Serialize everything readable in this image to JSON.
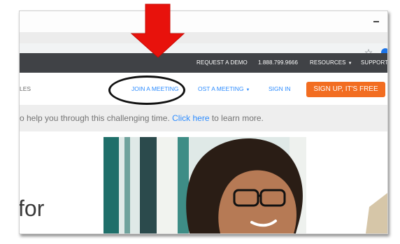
{
  "topbar": {
    "request_demo": "REQUEST A DEMO",
    "phone": "1.888.799.9666",
    "resources": "RESOURCES",
    "support": "SUPPORT"
  },
  "nav": {
    "sales_partial": "LES",
    "join": "JOIN A MEETING",
    "host_partial": "OST A MEETING",
    "sign_in": "SIGN IN",
    "signup": "SIGN UP, IT'S FREE"
  },
  "banner": {
    "text_before": "o help you through this challenging time. ",
    "link": "Click here",
    "text_after": " to learn more."
  },
  "hero": {
    "headline_partial": "for"
  },
  "colors": {
    "brand_blue": "#2d8cff",
    "cta_orange": "#f26d21",
    "topbar_dark": "#404246",
    "arrow_red": "#e8120c"
  },
  "icons": [
    "bookmark-star-icon",
    "extension-icon",
    "caret-down-icon",
    "red-arrow-icon"
  ]
}
